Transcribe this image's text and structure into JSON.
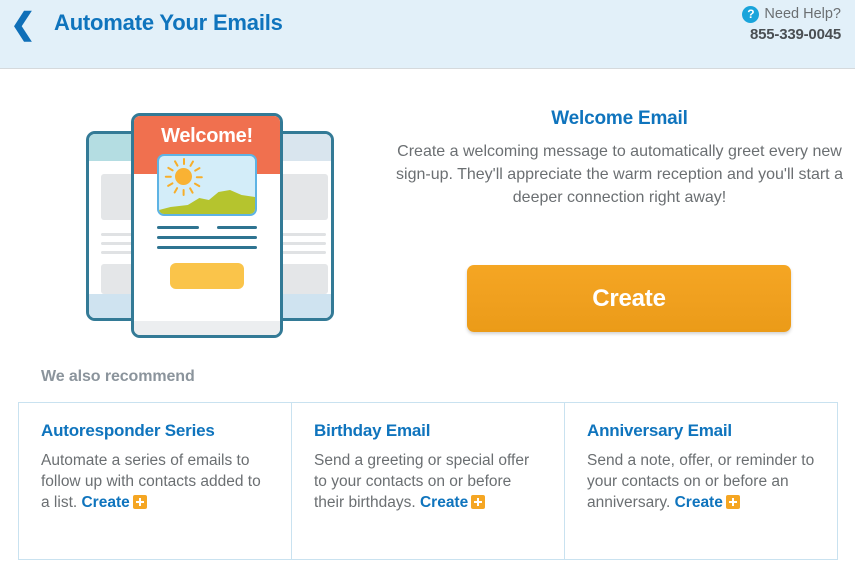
{
  "header": {
    "back_icon": "chevron-left-icon",
    "title": "Automate Your Emails",
    "help_icon": "question-mark-icon",
    "help_label": "Need Help?",
    "help_phone": "855-339-0045"
  },
  "illustration": {
    "welcome_label": "Welcome!",
    "colors": {
      "header_band": "#f0704f",
      "card_border": "#337a96",
      "sun": "#f9b233",
      "hill": "#b5c42e",
      "button": "#fac44a"
    }
  },
  "hero": {
    "title": "Welcome Email",
    "description": "Create a welcoming message to automatically greet every new sign-up. They'll appreciate the warm reception and you'll start a deeper connection right away!",
    "create_label": "Create"
  },
  "recommend": {
    "section_title": "We also recommend",
    "cards": [
      {
        "title": "Autoresponder Series",
        "body": "Automate a series of emails to follow up with contacts added to a list. ",
        "create_label": "Create"
      },
      {
        "title": "Birthday Email",
        "body": "Send a greeting or special offer to your contacts on or before their birthdays. ",
        "create_label": "Create"
      },
      {
        "title": "Anniversary Email",
        "body": "Send a note, offer, or reminder to your contacts on or before an anniversary. ",
        "create_label": "Create"
      }
    ]
  },
  "colors": {
    "brand_blue": "#0f74bd",
    "header_bg": "#e2f0f9",
    "accent_orange": "#f5a623",
    "muted_text": "#6b6f72",
    "card_border": "#c9e2f0"
  }
}
